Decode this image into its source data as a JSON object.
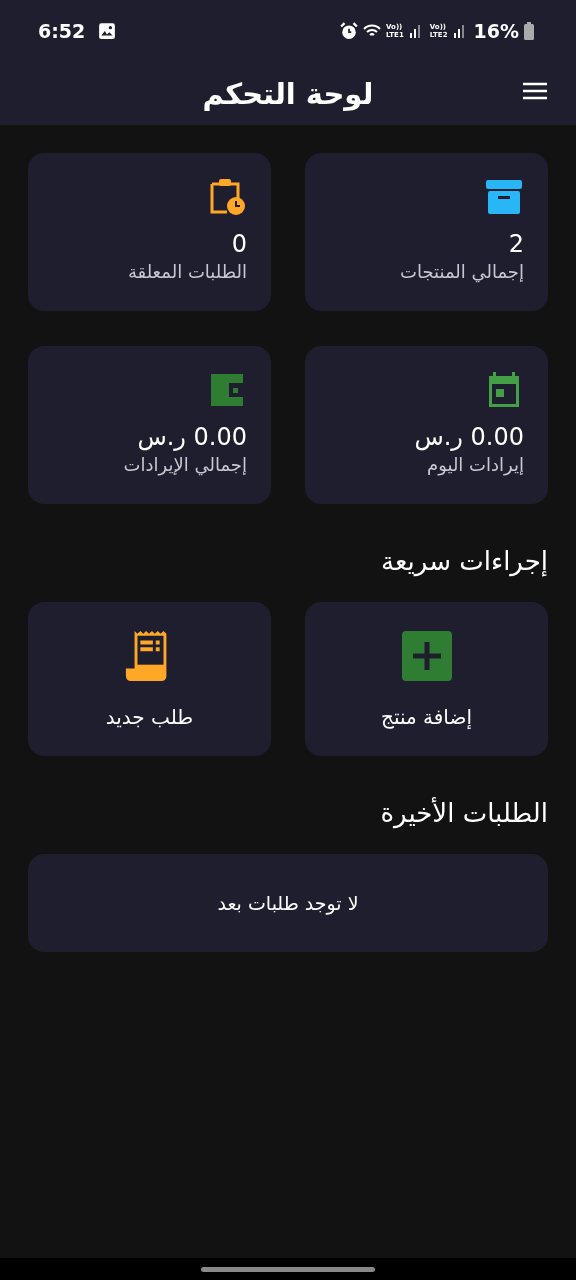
{
  "status_bar": {
    "time": "6:52",
    "networks": [
      {
        "top": "Vo))",
        "bottom": "LTE2"
      },
      {
        "top": "Vo))",
        "bottom": "LTE1"
      }
    ],
    "battery": "16%"
  },
  "header": {
    "title": "لوحة التحكم"
  },
  "stats": [
    {
      "value": "2",
      "label": "إجمالي المنتجات",
      "color": "#29b6f6"
    },
    {
      "value": "0",
      "label": "الطلبات المعلقة",
      "color": "#ffa726"
    },
    {
      "value": "0.00 ر.س",
      "label": "إيرادات اليوم",
      "color": "#43a047"
    },
    {
      "value": "0.00 ر.س",
      "label": "إجمالي الإيرادات",
      "color": "#2e7d32"
    }
  ],
  "quick_actions": {
    "title": "إجراءات سريعة",
    "items": [
      {
        "label": "إضافة منتج",
        "color": "#2e7d32"
      },
      {
        "label": "طلب جديد",
        "color": "#ffa726"
      }
    ]
  },
  "recent_orders": {
    "title": "الطلبات الأخيرة",
    "empty_message": "لا توجد طلبات بعد"
  }
}
